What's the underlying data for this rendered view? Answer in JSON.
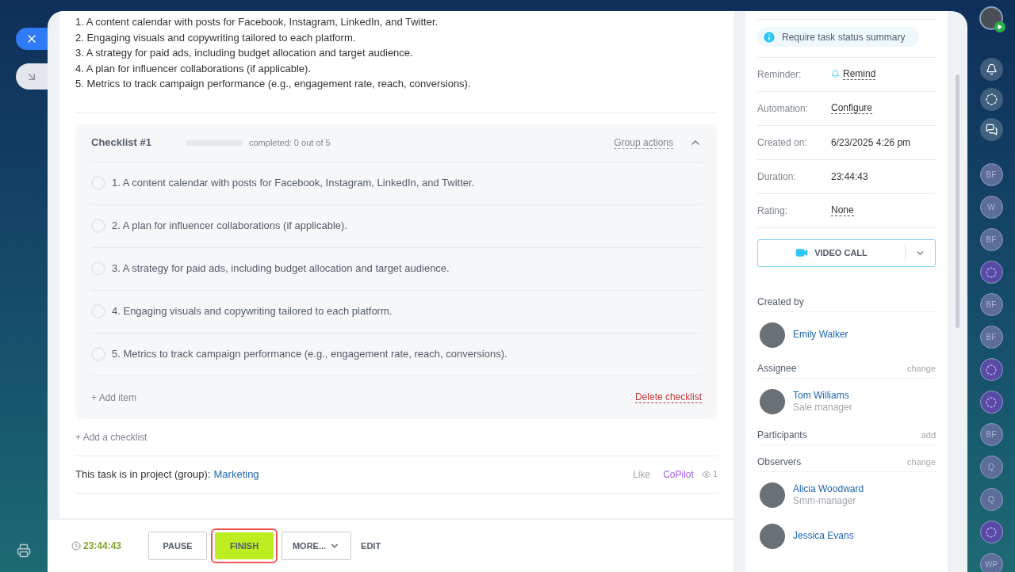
{
  "description_lines": [
    "1. A content calendar with posts for Facebook, Instagram, LinkedIn, and Twitter.",
    "2. Engaging visuals and copywriting tailored to each platform.",
    "3. A strategy for paid ads, including budget allocation and target audience.",
    "4. A plan for influencer collaborations (if applicable).",
    "5. Metrics to track campaign performance (e.g., engagement rate, reach, conversions)."
  ],
  "checklist": {
    "title": "Checklist #1",
    "level": 0,
    "progress_text": "completed: 0 out of 5",
    "group_actions": "Group actions",
    "expanded": true,
    "items": [
      {
        "number": "1.",
        "text": "A content calendar with posts for Facebook, Instagram, LinkedIn, and Twitter.",
        "checked": false
      },
      {
        "number": "2.",
        "text": "A plan for influencer collaborations (if applicable).",
        "checked": false
      },
      {
        "number": "3.",
        "text": "A strategy for paid ads, including budget allocation and target audience.",
        "checked": false
      },
      {
        "number": "4.",
        "text": "Engaging visuals and copywriting tailored to each platform.",
        "checked": false
      },
      {
        "number": "5.",
        "text": "Metrics to track campaign performance (e.g., engagement rate, reach, conversions).",
        "checked": false
      }
    ],
    "add_item": "+ Add item",
    "delete": "Delete checklist"
  },
  "add_checklist": "+ Add a checklist",
  "project": {
    "label": "This task is in project (group):",
    "name": "Marketing",
    "like": "Like",
    "copilot": "CoPilot",
    "views": "1"
  },
  "footer": {
    "timer": "23:44:43",
    "pause": "PAUSE",
    "finish": "FINISH",
    "more": "MORE...",
    "edit": "EDIT"
  },
  "sidebar": {
    "status_summary": "Require task status summary",
    "fields": [
      {
        "label": "Reminder:",
        "value": "Remind",
        "kind": "reminder"
      },
      {
        "label": "Automation:",
        "value": "Configure",
        "kind": "link"
      },
      {
        "label": "Created on:",
        "value": "6/23/2025 4:26 pm",
        "kind": "text"
      },
      {
        "label": "Duration:",
        "value": "23:44:43",
        "kind": "text"
      },
      {
        "label": "Rating:",
        "value": "None",
        "kind": "link"
      }
    ],
    "video_call": "VIDEO CALL",
    "roles": [
      {
        "title": "Created by",
        "people": [
          {
            "name": "Emily Walker"
          }
        ]
      },
      {
        "title": "Assignee",
        "action": "change",
        "people": [
          {
            "name": "Tom Williams",
            "role": "Sale manager"
          }
        ]
      },
      {
        "title": "Participants",
        "action": "add"
      },
      {
        "title": "Observers",
        "action": "change",
        "people": [
          {
            "name": "Alicia Woodward",
            "role": "Smm-manager"
          },
          {
            "name": "Jessica Evans"
          }
        ]
      }
    ]
  },
  "rail": [
    {
      "kind": "initials",
      "text": "BF"
    },
    {
      "kind": "initials",
      "text": "W"
    },
    {
      "kind": "initials",
      "text": "BF"
    },
    {
      "kind": "icon"
    },
    {
      "kind": "initials",
      "text": "BF"
    },
    {
      "kind": "initials",
      "text": "BF"
    },
    {
      "kind": "icon"
    },
    {
      "kind": "icon"
    },
    {
      "kind": "initials",
      "text": "BF"
    },
    {
      "kind": "initials",
      "text": "Q"
    },
    {
      "kind": "initials",
      "text": "Q"
    },
    {
      "kind": "icon"
    },
    {
      "kind": "initials",
      "text": "WP"
    }
  ]
}
